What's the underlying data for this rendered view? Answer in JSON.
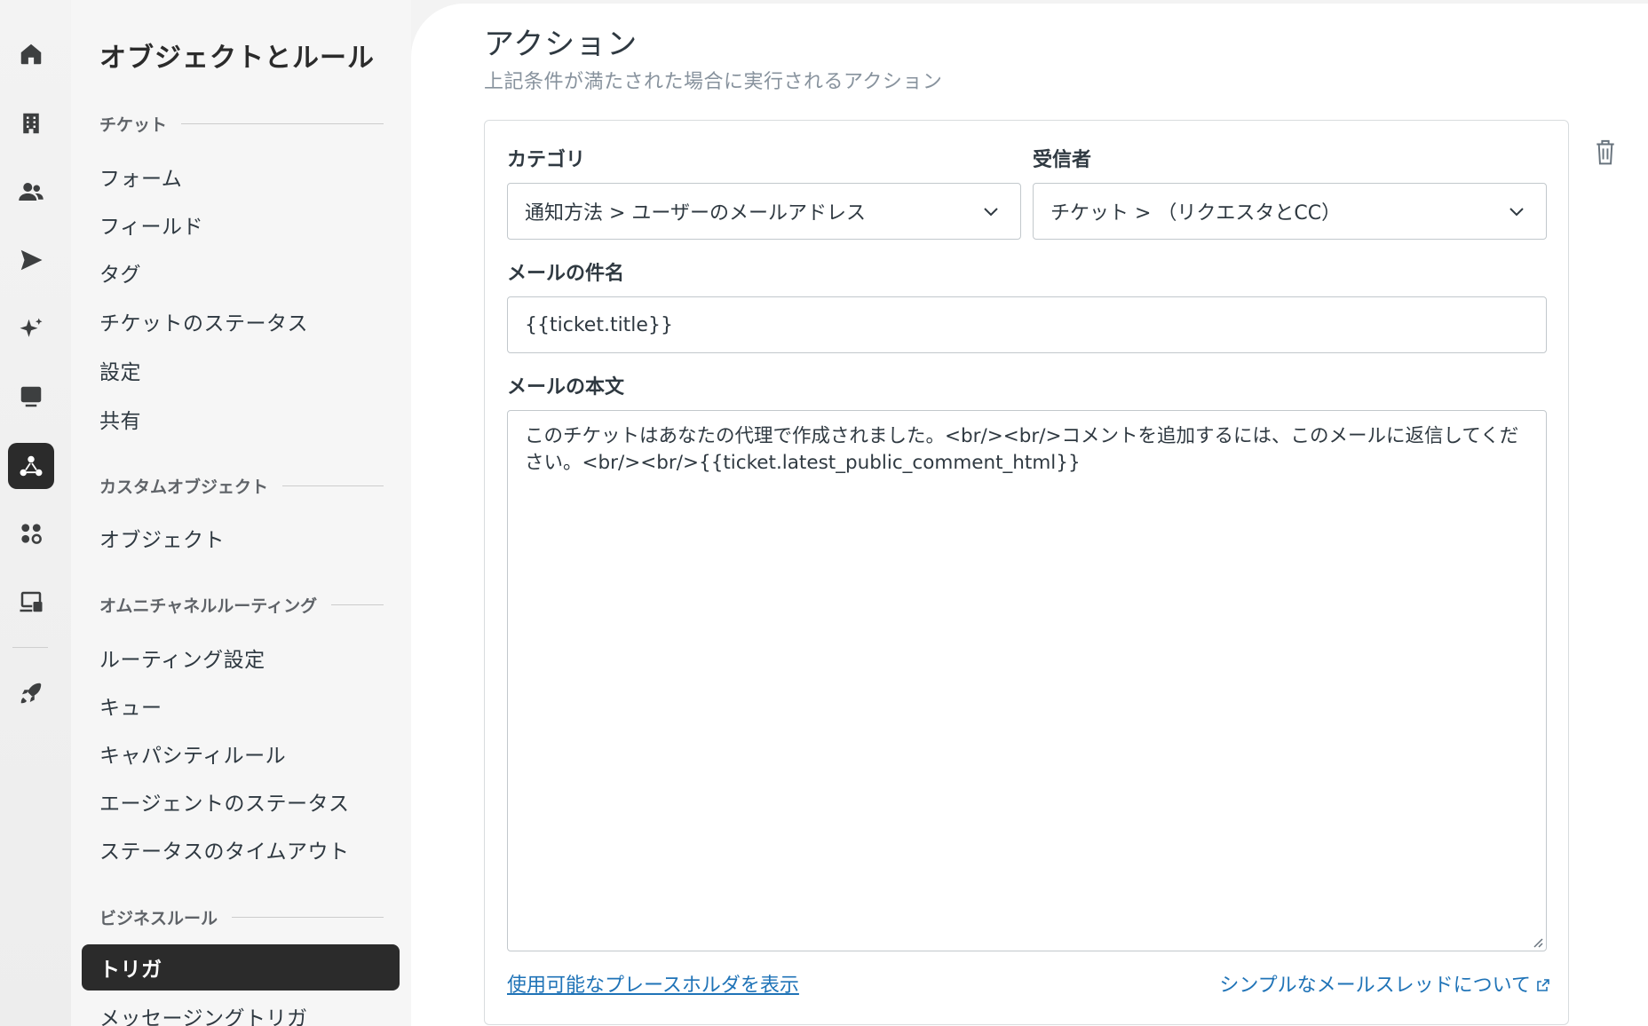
{
  "rail": {
    "items": [
      {
        "icon": "home-icon"
      },
      {
        "icon": "building-icon"
      },
      {
        "icon": "people-icon"
      },
      {
        "icon": "send-icon"
      },
      {
        "icon": "sparkle-icon"
      },
      {
        "icon": "monitor-icon"
      },
      {
        "icon": "objects-rules-icon",
        "active": true
      },
      {
        "icon": "apps-icon"
      },
      {
        "icon": "workspace-icon"
      },
      {
        "icon": "rocket-icon"
      }
    ]
  },
  "nav": {
    "title": "オブジェクトとルール",
    "sections": {
      "tickets": "チケット",
      "custom_objects": "カスタムオブジェクト",
      "omnichannel": "オムニチャネルルーティング",
      "business_rules": "ビジネスルール"
    },
    "items": {
      "forms": "フォーム",
      "fields": "フィールド",
      "tags": "タグ",
      "ticket_statuses": "チケットのステータス",
      "settings": "設定",
      "sharing": "共有",
      "objects": "オブジェクト",
      "routing_settings": "ルーティング設定",
      "queues": "キュー",
      "capacity_rules": "キャパシティルール",
      "agent_statuses": "エージェントのステータス",
      "status_timeout": "ステータスのタイムアウト",
      "triggers": "トリガ",
      "messaging_triggers": "メッセージングトリガ"
    }
  },
  "main": {
    "title": "アクション",
    "subtitle": "上記条件が満たされた場合に実行されるアクション",
    "category_label": "カテゴリ",
    "category_value": "通知方法 > ユーザーのメールアドレス",
    "recipient_label": "受信者",
    "recipient_value": "チケット > （リクエスタとCC）",
    "subject_label": "メールの件名",
    "subject_value": "{{ticket.title}}",
    "body_label": "メールの本文",
    "body_value": "このチケットはあなたの代理で作成されました。<br/><br/>コメントを追加するには、このメールに返信してください。<br/><br/>{{ticket.latest_public_comment_html}}",
    "placeholders_link": "使用可能なプレースホルダを表示",
    "simple_thread_link": "シンプルなメールスレッドについて"
  },
  "colors": {
    "accent_link": "#1f73b7",
    "active_nav": "#2b2b2b",
    "text": "#2f3941",
    "muted": "#87929d"
  }
}
